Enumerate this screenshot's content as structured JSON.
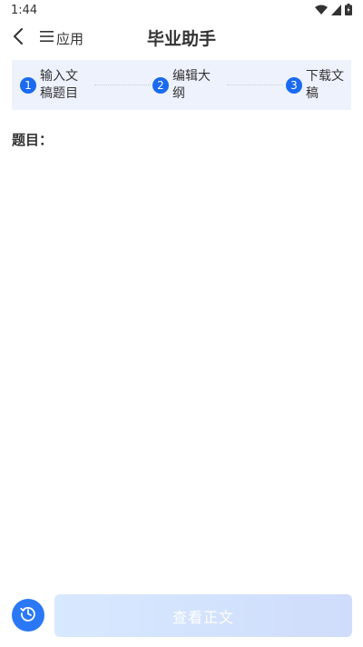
{
  "status_bar": {
    "time": "1:44",
    "icons": [
      "wifi-icon",
      "signal-icon",
      "battery-icon"
    ]
  },
  "navbar": {
    "back_icon": "chevron-left-icon",
    "apps_icon": "menu-icon",
    "apps_label": "应用",
    "title": "毕业助手"
  },
  "steps": [
    {
      "number": "1",
      "label": "输入文稿题目"
    },
    {
      "number": "2",
      "label": "编辑大纲"
    },
    {
      "number": "3",
      "label": "下载文稿"
    }
  ],
  "topic": {
    "label": "题目："
  },
  "bottom": {
    "history_icon": "history-icon",
    "view_button_label": "查看正文"
  },
  "colors": {
    "accent": "#1a6bf0",
    "steps_background": "#eef2fd",
    "button_gradient_start": "#d7e9ff",
    "button_gradient_end": "#cfdcfb"
  }
}
